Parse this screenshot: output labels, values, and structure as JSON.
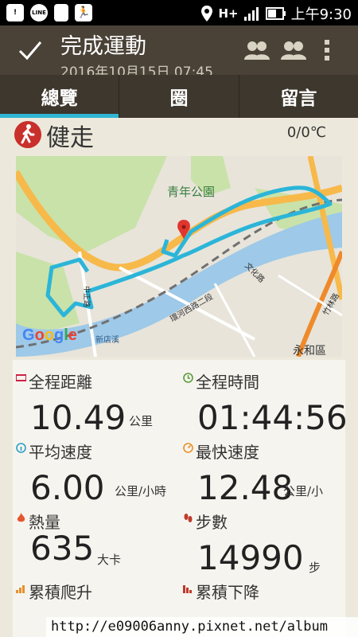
{
  "status_bar": {
    "time": "上午9:30",
    "network": "H+",
    "icons": [
      "notification-icon",
      "line-icon",
      "phone-icon",
      "runner-icon",
      "location-icon",
      "signal-icon",
      "battery-icon"
    ]
  },
  "action_bar": {
    "title": "完成運動",
    "subtitle": "2016年10月15日 07:45"
  },
  "tabs": [
    {
      "label": "總覽",
      "active": true
    },
    {
      "label": "圈",
      "active": false
    },
    {
      "label": "留言",
      "active": false
    }
  ],
  "activity": {
    "name": "健走",
    "temperature": "0/0℃"
  },
  "map": {
    "labels": {
      "park": "青年公園",
      "district": "永和區",
      "road1": "文化路",
      "road2": "環河西路二段",
      "road3": "竹林路",
      "road4": "中正路",
      "road5": "新店溪"
    },
    "attribution": "Google"
  },
  "stats": [
    {
      "label": "全程距離",
      "value": "10.49",
      "unit": "公里"
    },
    {
      "label": "全程時間",
      "value": "01:44:56",
      "unit": ""
    },
    {
      "label": "平均速度",
      "value": "6.00",
      "unit": "公里/小時"
    },
    {
      "label": "最快速度",
      "value": "12.48",
      "unit": "公里/小"
    },
    {
      "label": "熱量",
      "value": "635",
      "unit": "大卡"
    },
    {
      "label": "步數",
      "value": "14990",
      "unit": "步"
    },
    {
      "label": "累積爬升",
      "value": "",
      "unit": ""
    },
    {
      "label": "累積下降",
      "value": "",
      "unit": ""
    }
  ],
  "watermark": "http://e09006anny.pixnet.net/album",
  "colors": {
    "actionbar": "#4a4237",
    "tab_indicator": "#30b6d2",
    "route": "#2bb5d8",
    "activity_icon": "#c9302c"
  }
}
